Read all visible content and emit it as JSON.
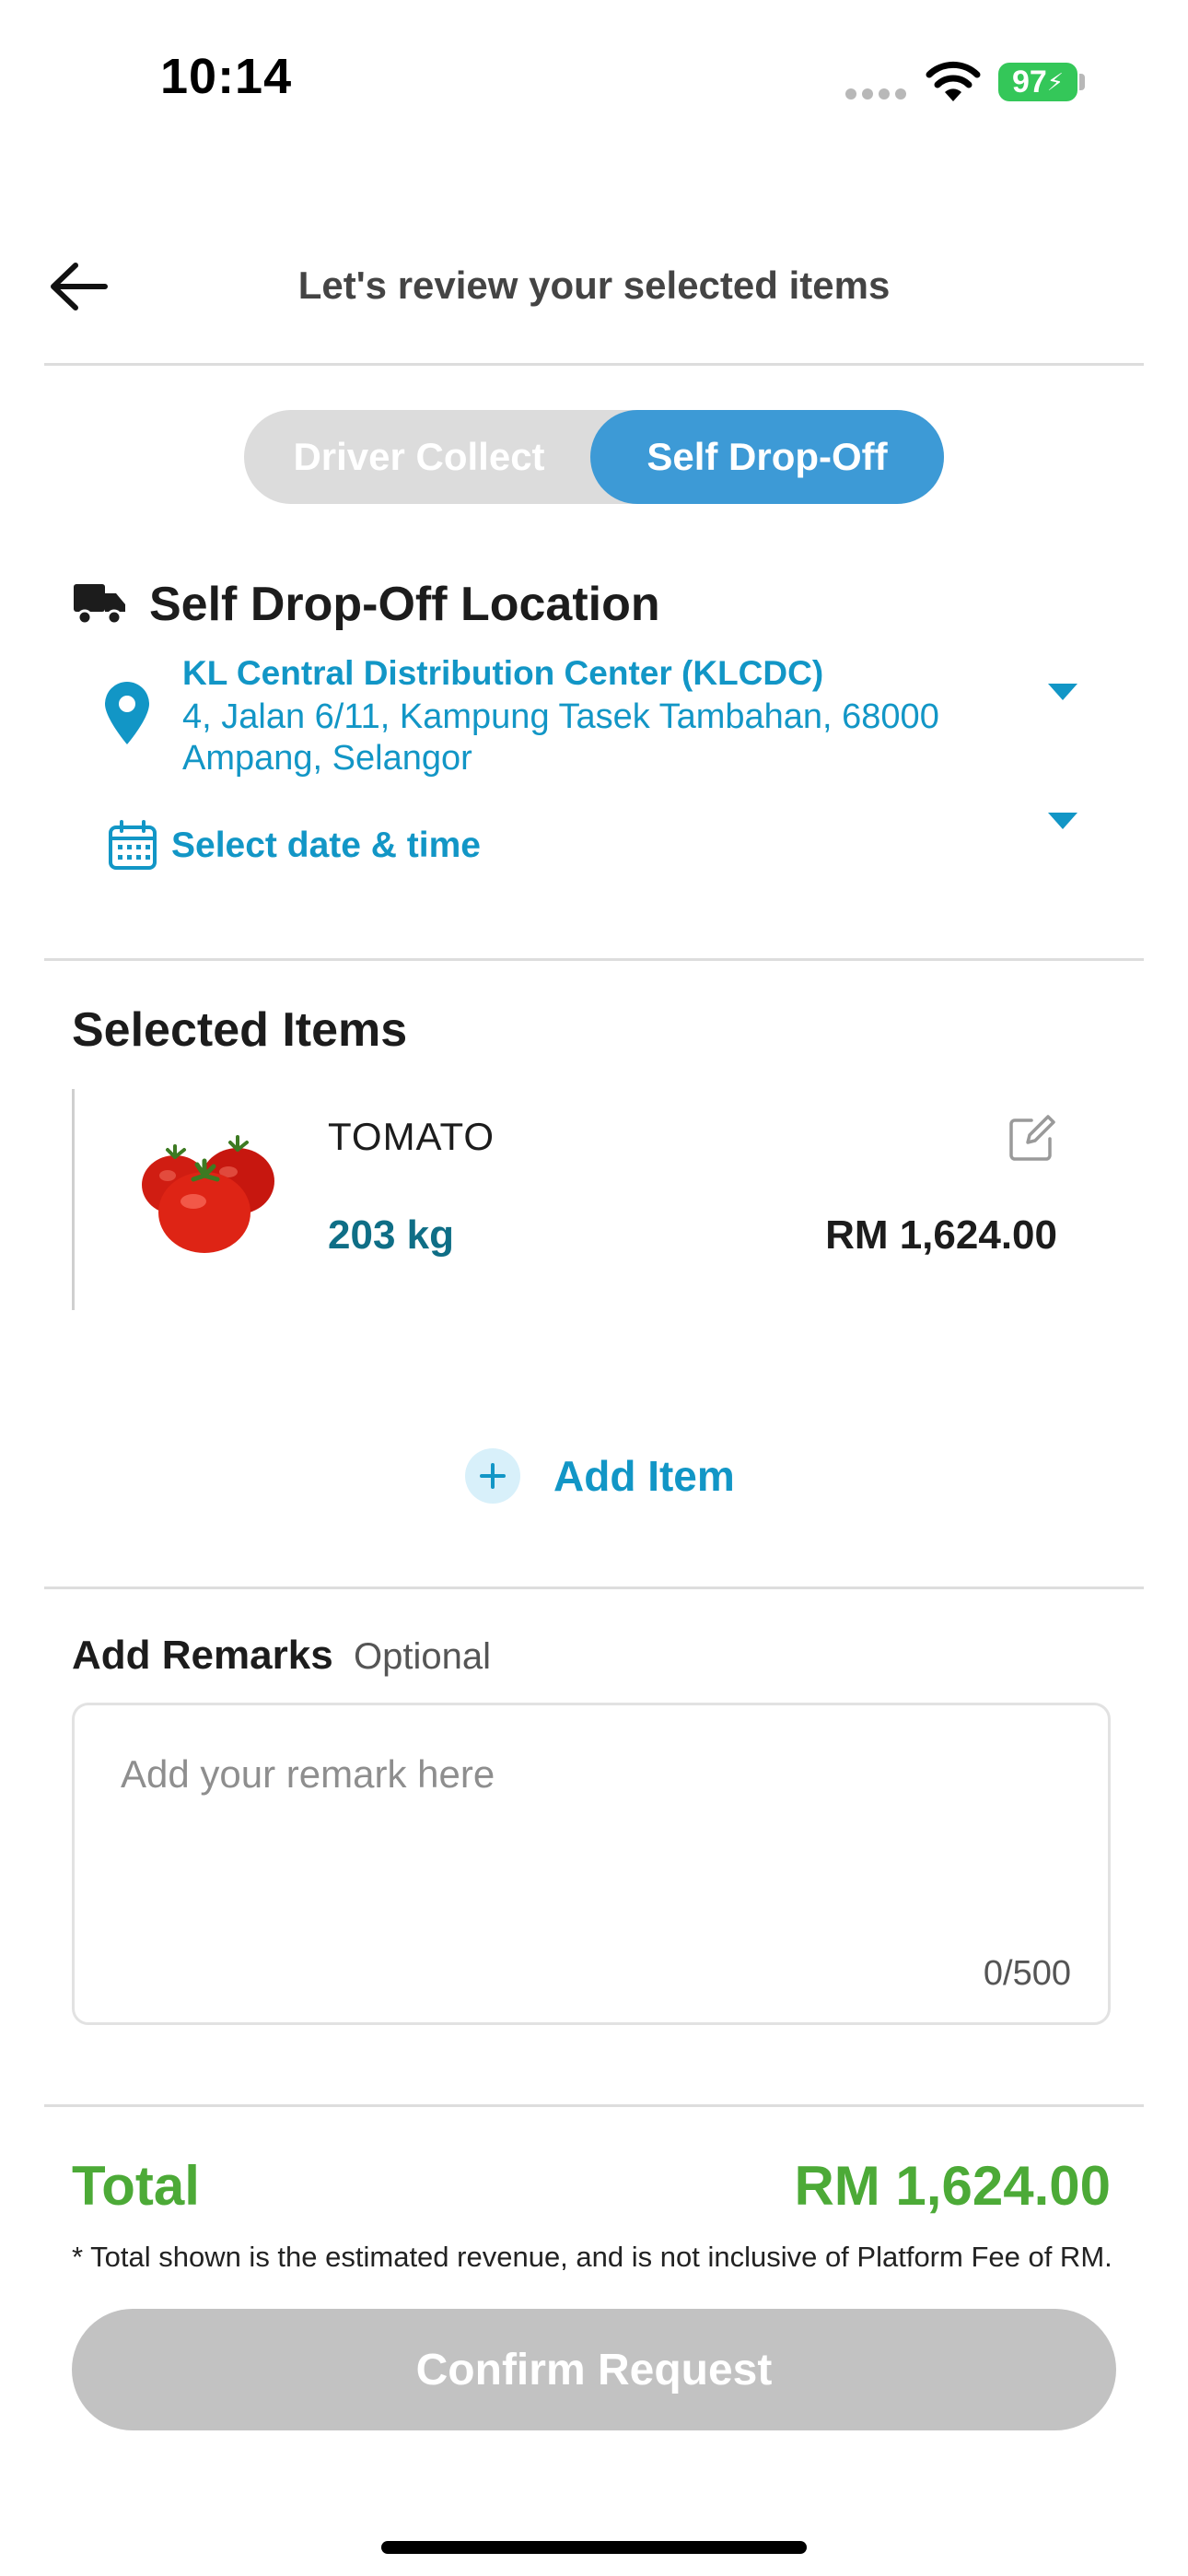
{
  "status_bar": {
    "time": "10:14",
    "battery": "97"
  },
  "header": {
    "title": "Let's review your selected items"
  },
  "mode_toggle": {
    "options": [
      "Driver Collect",
      "Self Drop-Off"
    ],
    "selected": "Self Drop-Off"
  },
  "location": {
    "heading": "Self Drop-Off Location",
    "name": "KL Central Distribution Center (KLCDC)",
    "address": "4, Jalan 6/11, Kampung Tasek Tambahan, 68000 Ampang, Selangor",
    "date_time_placeholder": "Select date & time"
  },
  "selected_items": {
    "heading": "Selected Items",
    "items": [
      {
        "name": "TOMATO",
        "quantity": "203 kg",
        "price": "RM 1,624.00",
        "image_icon": "tomato-image"
      }
    ],
    "add_item_label": "Add Item"
  },
  "remarks": {
    "heading": "Add Remarks",
    "optional_label": "Optional",
    "placeholder": "Add your remark here",
    "value": "",
    "char_count": "0/500"
  },
  "summary": {
    "total_label": "Total",
    "total_value": "RM 1,624.00",
    "note": "* Total shown is the estimated revenue, and is not inclusive of Platform Fee of RM.",
    "confirm_label": "Confirm Request"
  },
  "colors": {
    "accent_blue": "#1296c6",
    "toggle_active": "#3d9ad6",
    "total_green": "#4caa37",
    "button_disabled": "#c2c2c2"
  }
}
